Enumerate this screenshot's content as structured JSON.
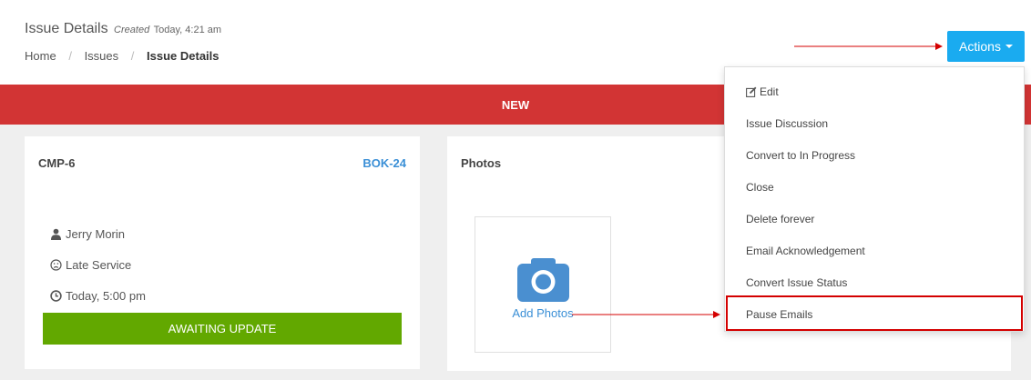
{
  "header": {
    "title": "Issue Details",
    "created_label": "Created",
    "created_time": "Today, 4:21 am",
    "breadcrumb": [
      "Home",
      "Issues",
      "Issue Details"
    ],
    "separator": "/"
  },
  "actions": {
    "label": "Actions"
  },
  "status": {
    "label": "NEW",
    "color": "#d23434"
  },
  "issue_card": {
    "id": "CMP-6",
    "ref": "BOK-24",
    "assignee": "Jerry Morin",
    "reason": "Late Service",
    "due": "Today, 5:00 pm",
    "state_label": "AWAITING UPDATE",
    "state_color": "#62a800"
  },
  "photos_card": {
    "title": "Photos",
    "add_label": "Add Photos"
  },
  "dropdown": {
    "items": [
      "Edit",
      "Issue Discussion",
      "Convert to In Progress",
      "Close",
      "Delete forever",
      "Email Acknowledgement",
      "Convert Issue Status",
      "Pause Emails"
    ],
    "highlighted": "Pause Emails"
  },
  "colors": {
    "accent": "#1aabf0",
    "link": "#3a8fd6",
    "annotation": "#d40000"
  }
}
